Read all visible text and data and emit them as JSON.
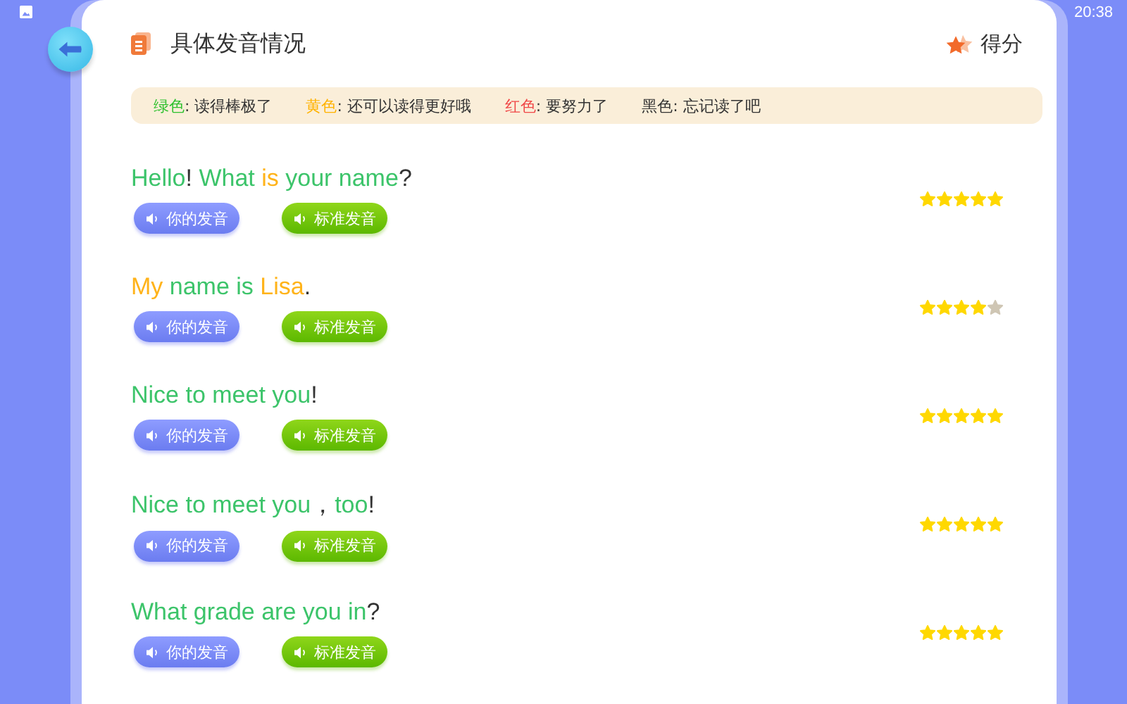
{
  "status_bar": {
    "time": "20:38"
  },
  "header": {
    "title": "具体发音情况",
    "score_label": "得分"
  },
  "legend": [
    {
      "name": "绿色",
      "color": "#2fc12f",
      "meaning": ": 读得棒极了"
    },
    {
      "name": "黄色",
      "color": "#ffb300",
      "meaning": ": 还可以读得更好哦"
    },
    {
      "name": "红色",
      "color": "#f04848",
      "meaning": ": 要努力了"
    },
    {
      "name": "黑色",
      "color": "#333333",
      "meaning": ": 忘记读了吧"
    }
  ],
  "sentences": [
    {
      "segments": [
        {
          "text": "Hello",
          "color": "#3cc46a"
        },
        {
          "text": "! ",
          "color": "#333333"
        },
        {
          "text": "What ",
          "color": "#3cc46a"
        },
        {
          "text": "is ",
          "color": "#ffb31a"
        },
        {
          "text": "your name",
          "color": "#3cc46a"
        },
        {
          "text": "?",
          "color": "#333333"
        }
      ],
      "your_button": "你的发音",
      "standard_button": "标准发音",
      "stars": 5
    },
    {
      "segments": [
        {
          "text": "My ",
          "color": "#ffb31a"
        },
        {
          "text": "name is ",
          "color": "#3cc46a"
        },
        {
          "text": "Lisa",
          "color": "#ffb31a"
        },
        {
          "text": ".",
          "color": "#333333"
        }
      ],
      "your_button": "你的发音",
      "standard_button": "标准发音",
      "stars": 4
    },
    {
      "segments": [
        {
          "text": "Nice to meet you",
          "color": "#3cc46a"
        },
        {
          "text": "!",
          "color": "#333333"
        }
      ],
      "your_button": "你的发音",
      "standard_button": "标准发音",
      "stars": 5
    },
    {
      "segments": [
        {
          "text": "Nice to meet you",
          "color": "#3cc46a"
        },
        {
          "text": "，",
          "color": "#333333"
        },
        {
          "text": "too",
          "color": "#3cc46a"
        },
        {
          "text": "!",
          "color": "#333333"
        }
      ],
      "your_button": "你的发音",
      "standard_button": "标准发音",
      "stars": 5
    },
    {
      "segments": [
        {
          "text": "What grade are you in",
          "color": "#3cc46a"
        },
        {
          "text": "?",
          "color": "#333333"
        }
      ],
      "your_button": "你的发音",
      "standard_button": "标准发音",
      "stars": 5
    }
  ]
}
